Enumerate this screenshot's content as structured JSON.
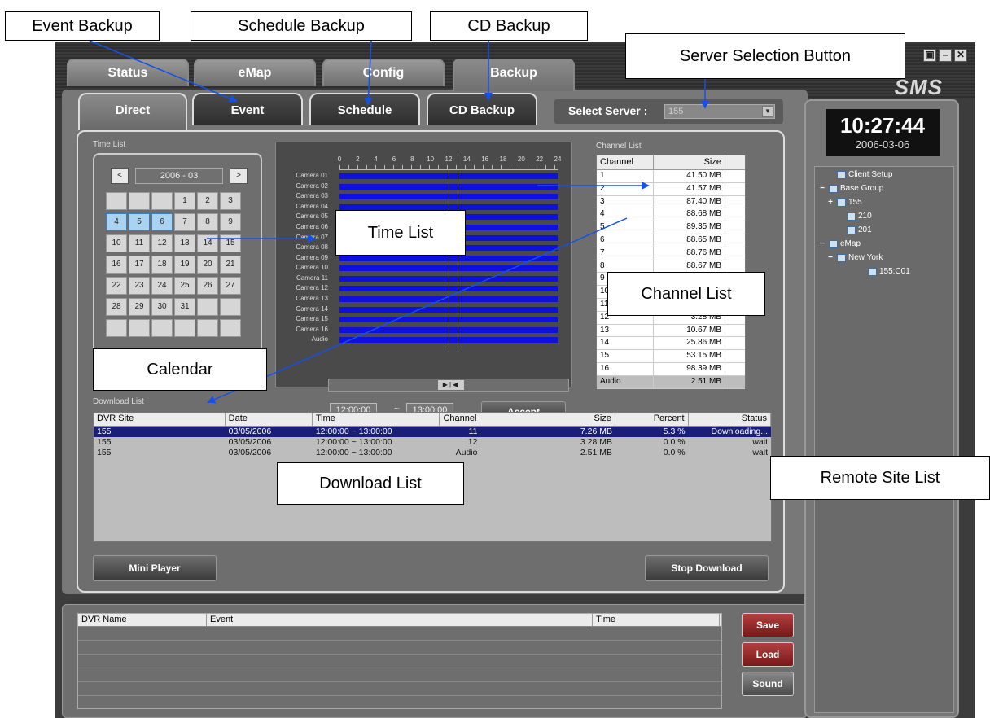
{
  "top_tabs": [
    {
      "label": "Status"
    },
    {
      "label": "eMap"
    },
    {
      "label": "Config"
    },
    {
      "label": "Backup"
    }
  ],
  "sub_tabs": [
    {
      "label": "Direct"
    },
    {
      "label": "Event"
    },
    {
      "label": "Schedule"
    },
    {
      "label": "CD Backup"
    }
  ],
  "server": {
    "label": "Select Server :",
    "value": "155"
  },
  "time_list_label": "Time List",
  "calendar": {
    "month": "2006 - 03",
    "prev": "<",
    "next": ">",
    "cells": [
      "",
      "",
      "",
      "1",
      "2",
      "3",
      "4",
      "5",
      "6",
      "7",
      "8",
      "9",
      "10",
      "11",
      "12",
      "13",
      "14",
      "15",
      "16",
      "17",
      "18",
      "19",
      "20",
      "21",
      "22",
      "23",
      "24",
      "25",
      "26",
      "27",
      "28",
      "29",
      "30",
      "31",
      "",
      "",
      "",
      "",
      "",
      "",
      "",
      ""
    ],
    "highlighted": [
      "4",
      "5",
      "6"
    ]
  },
  "timeline": {
    "ticks": [
      "0",
      "2",
      "4",
      "6",
      "8",
      "10",
      "12",
      "14",
      "16",
      "18",
      "20",
      "22",
      "24"
    ],
    "rows": [
      "Camera 01",
      "Camera 02",
      "Camera 03",
      "Camera 04",
      "Camera 05",
      "Camera 06",
      "Camera 07",
      "Camera 08",
      "Camera 09",
      "Camera 10",
      "Camera 11",
      "Camera 12",
      "Camera 13",
      "Camera 14",
      "Camera 15",
      "Camera 16",
      "Audio"
    ],
    "selection_start_hour": 12,
    "selection_end_hour": 13,
    "from": "12:00:00",
    "to": "13:00:00",
    "tilde": "~",
    "scroll_thumb": "▶|◀",
    "accept": "Accept",
    "bar_color": "#0e10e0"
  },
  "channel_list": {
    "label": "Channel List",
    "headers": [
      "Channel",
      "Size"
    ],
    "rows": [
      [
        "1",
        "41.50 MB"
      ],
      [
        "2",
        "41.57 MB"
      ],
      [
        "3",
        "87.40 MB"
      ],
      [
        "4",
        "88.68 MB"
      ],
      [
        "5",
        "89.35 MB"
      ],
      [
        "6",
        "88.65 MB"
      ],
      [
        "7",
        "88.76 MB"
      ],
      [
        "8",
        "88.67 MB"
      ],
      [
        "9",
        ""
      ],
      [
        "10",
        ""
      ],
      [
        "11",
        ""
      ],
      [
        "12",
        "3.28 MB"
      ],
      [
        "13",
        "10.67 MB"
      ],
      [
        "14",
        "25.86 MB"
      ],
      [
        "15",
        "53.15 MB"
      ],
      [
        "16",
        "98.39 MB"
      ],
      [
        "Audio",
        "2.51 MB"
      ]
    ]
  },
  "download_list": {
    "label": "Download List",
    "headers": [
      "DVR Site",
      "Date",
      "Time",
      "Channel",
      "Size",
      "Percent",
      "Status"
    ],
    "rows": [
      [
        "155",
        "03/05/2006",
        "12:00:00 ~ 13:00:00",
        "11",
        "7.26 MB",
        "5.3 %",
        "Downloading..."
      ],
      [
        "155",
        "03/05/2006",
        "12:00:00 ~ 13:00:00",
        "12",
        "3.28 MB",
        "0.0 %",
        "wait"
      ],
      [
        "155",
        "03/05/2006",
        "12:00:00 ~ 13:00:00",
        "Audio",
        "2.51 MB",
        "0.0 %",
        "wait"
      ]
    ],
    "mini_player": "Mini Player",
    "stop_download": "Stop Download"
  },
  "event_log": {
    "headers": [
      "DVR Name",
      "Event",
      "Time"
    ],
    "save": "Save",
    "load": "Load",
    "sound": "Sound"
  },
  "right_panel": {
    "logo": "SMS",
    "time": "10:27:44",
    "date": "2006-03-06",
    "tree": [
      {
        "exp": "",
        "label": "Client Setup"
      },
      {
        "exp": "−",
        "label": "Base Group"
      },
      {
        "exp": "+",
        "label": "155"
      },
      {
        "exp": "",
        "label": "210"
      },
      {
        "exp": "",
        "label": "201"
      },
      {
        "exp": "−",
        "label": "eMap"
      },
      {
        "exp": "−",
        "label": "New York"
      },
      {
        "exp": "",
        "label": "155:C01"
      }
    ]
  },
  "window_buttons": [
    "▣",
    "–",
    "✕"
  ],
  "callouts": {
    "event_backup": "Event Backup",
    "schedule_backup": "Schedule Backup",
    "cd_backup": "CD Backup",
    "server_selection": "Server Selection Button",
    "time_list": "Time List",
    "channel_list": "Channel List",
    "calendar": "Calendar",
    "download_list": "Download List",
    "remote_site_list": "Remote Site List"
  }
}
